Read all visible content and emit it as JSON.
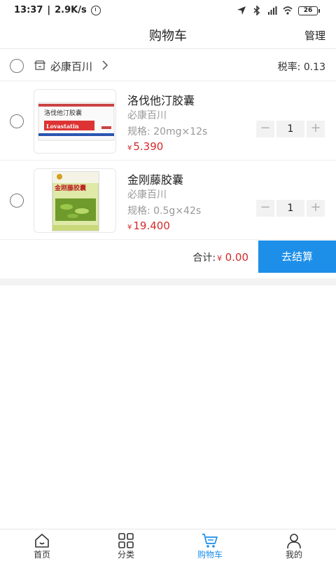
{
  "status_bar": {
    "time": "13:37",
    "net_speed": "2.9K/s",
    "battery": "26"
  },
  "header": {
    "title": "购物车",
    "action": "管理"
  },
  "store": {
    "name": "必康百川",
    "tax_label": "税率:",
    "tax_value": "0.13"
  },
  "items": [
    {
      "name": "洛伐他汀胶囊",
      "store": "必康百川",
      "spec_label": "规格:",
      "spec": "20mg×12s",
      "currency": "¥",
      "price": "5.390",
      "quantity": "1",
      "minus": "−",
      "plus": "+",
      "box_title": "洛伐他汀胶囊",
      "box_brand": "Lovastatin"
    },
    {
      "name": "金刚藤胶囊",
      "store": "必康百川",
      "spec_label": "规格:",
      "spec": "0.5g×42s",
      "currency": "¥",
      "price": "19.400",
      "quantity": "1",
      "minus": "−",
      "plus": "+",
      "box_title": "金刚藤胶囊"
    }
  ],
  "checkout": {
    "total_label": "合计:",
    "currency": "¥",
    "total": "0.00",
    "button": "去结算"
  },
  "nav": [
    {
      "label": "首页",
      "icon": "home-icon"
    },
    {
      "label": "分类",
      "icon": "category-icon"
    },
    {
      "label": "购物车",
      "icon": "cart-icon",
      "active": true
    },
    {
      "label": "我的",
      "icon": "user-icon"
    }
  ],
  "colors": {
    "accent": "#1d8fe8",
    "price": "#d32b2b"
  }
}
